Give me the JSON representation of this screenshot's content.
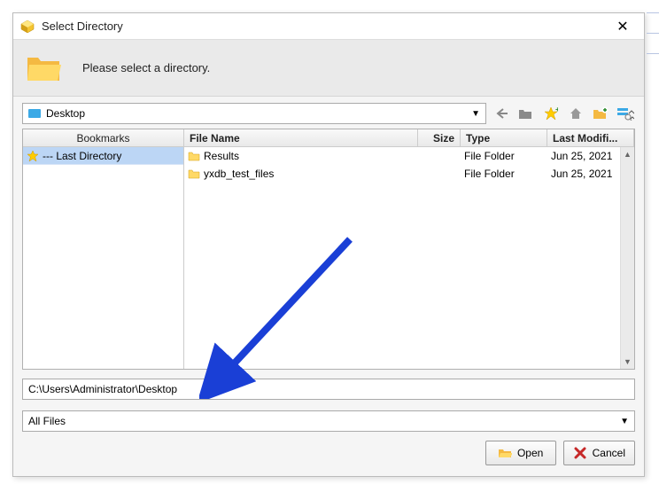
{
  "title": "Select Directory",
  "banner_text": "Please select a directory.",
  "location": "Desktop",
  "bookmarks": {
    "header": "Bookmarks",
    "items": [
      {
        "label": "--- Last Directory"
      }
    ]
  },
  "columns": {
    "name": "File Name",
    "size": "Size",
    "type": "Type",
    "modified": "Last Modifi..."
  },
  "files": [
    {
      "name": "Results",
      "size": "",
      "type": "File Folder",
      "modified": "Jun 25, 2021"
    },
    {
      "name": "yxdb_test_files",
      "size": "",
      "type": "File Folder",
      "modified": "Jun 25, 2021"
    }
  ],
  "path": "C:\\Users\\Administrator\\Desktop",
  "filter": "All Files",
  "buttons": {
    "open": "Open",
    "cancel": "Cancel"
  }
}
